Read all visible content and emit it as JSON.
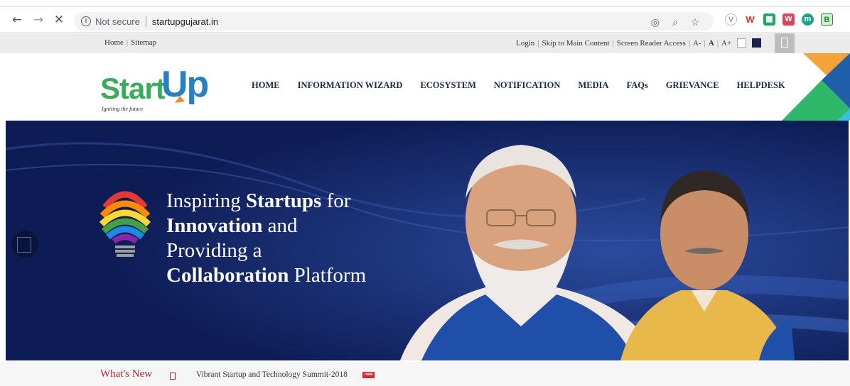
{
  "browser": {
    "back_icon": "arrow-left-icon",
    "forward_icon": "arrow-right-icon",
    "stop_icon": "close-icon",
    "security_label": "Not secure",
    "url": "startupgujarat.in",
    "extensions": [
      {
        "name": "vivaldi-ext",
        "glyph": "V",
        "color": "#ffffff",
        "bg": "#b7b7b7"
      },
      {
        "name": "w-ext",
        "glyph": "W",
        "color": "#d32f2f",
        "bg": "#ffffff"
      },
      {
        "name": "sheets-ext",
        "glyph": "▦",
        "color": "#ffffff",
        "bg": "#1fa463"
      },
      {
        "name": "office-ext",
        "glyph": "W",
        "color": "#ffffff",
        "bg": "#e0405a"
      },
      {
        "name": "m-ext",
        "glyph": "m",
        "color": "#ffffff",
        "bg": "#1aa58a"
      },
      {
        "name": "green-ext",
        "glyph": "B",
        "color": "#1b8a3e",
        "bg": "#d8eed0"
      }
    ]
  },
  "utility": {
    "left_links": [
      "Home",
      "Sitemap"
    ],
    "right_links": [
      "Login",
      "Skip to Main Content",
      "Screen Reader Access"
    ],
    "font_controls": [
      "A-",
      "A",
      "A+"
    ]
  },
  "logo": {
    "start": "Start",
    "up": "Up",
    "tagline": "Igniting the future"
  },
  "nav": [
    "HOME",
    "INFORMATION WIZARD",
    "ECOSYSTEM",
    "NOTIFICATION",
    "MEDIA",
    "FAQs",
    "GRIEVANCE",
    "HELPDESK"
  ],
  "hero": {
    "line1_a": "Inspiring ",
    "line1_b": "Startups",
    "line1_c": " for",
    "line2_a": "Innovation",
    "line2_b": " and",
    "line3": "Providing a",
    "line4_a": "Collaboration",
    "line4_b": " Platform"
  },
  "whats_new": {
    "title": "What's New",
    "item": "Vibrant Startup and Technology Summit-2018",
    "badge": "new"
  },
  "colors": {
    "hero_bg": "#11215f",
    "nav_text": "#1c2b4a",
    "logo_green": "#3aab5a",
    "logo_blue": "#2a7fc1",
    "whats_new_red": "#b3262d"
  }
}
